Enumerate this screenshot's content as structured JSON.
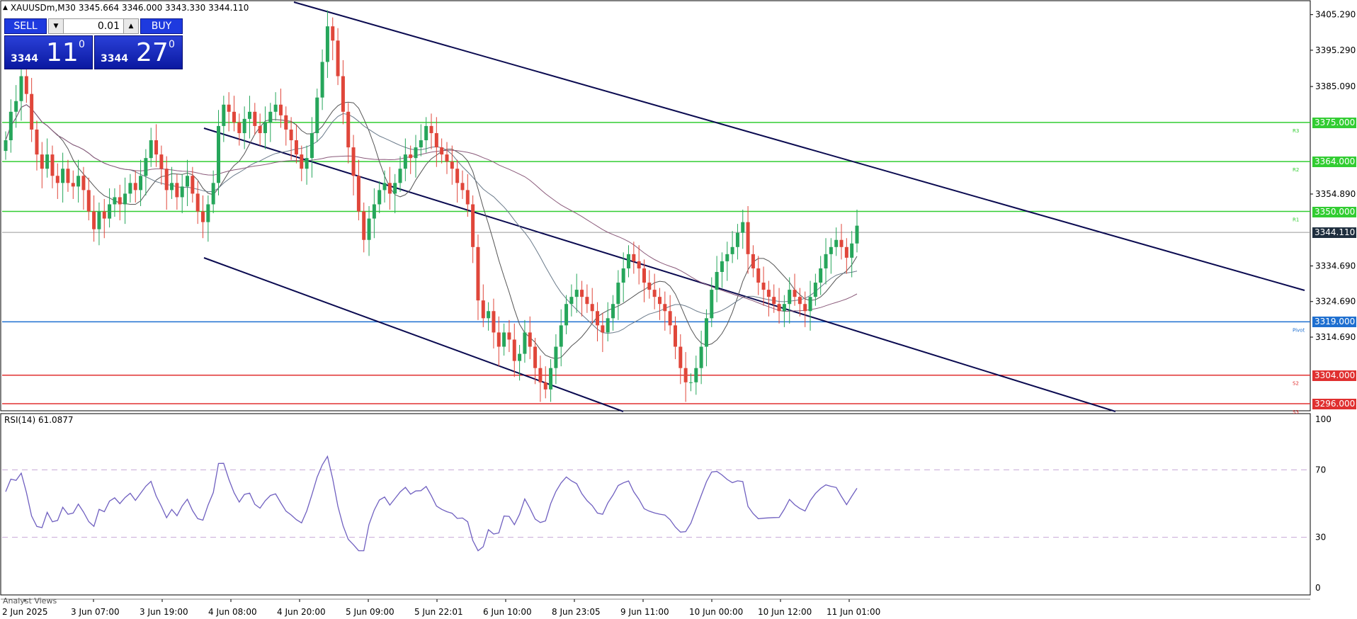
{
  "header": {
    "symbol": "XAUUSDm,M30",
    "ohlc": "3345.664  3346.000  3343.330  3344.110"
  },
  "trade_panel": {
    "sell_label": "SELL",
    "buy_label": "BUY",
    "lot": "0.01",
    "sell_price": {
      "base": "3344",
      "big": "11",
      "sup": "0"
    },
    "buy_price": {
      "base": "3344",
      "big": "27",
      "sup": "0"
    }
  },
  "price_axis": {
    "ticks": [
      "3405.290",
      "3395.290",
      "3385.090",
      "3354.890",
      "3334.690",
      "3324.690",
      "3314.690"
    ],
    "levels": [
      {
        "name": "R3",
        "value": "3375.000",
        "color": "#32cd32"
      },
      {
        "name": "R2",
        "value": "3364.000",
        "color": "#32cd32"
      },
      {
        "name": "R1",
        "value": "3350.000",
        "color": "#32cd32"
      },
      {
        "name": "Pivot",
        "value": "3319.000",
        "color": "#1e6fd0"
      },
      {
        "name": "S2",
        "value": "3304.000",
        "color": "#e03030"
      },
      {
        "name": "S3",
        "value": "3296.000",
        "color": "#e03030"
      }
    ],
    "current": "3344.110"
  },
  "rsi": {
    "label": "RSI(14) 61.0877",
    "ticks": [
      "100",
      "70",
      "30",
      "0"
    ],
    "color": "#7060c0"
  },
  "time_axis": [
    "2 Jun 2025",
    "3 Jun 07:00",
    "3 Jun 19:00",
    "4 Jun 08:00",
    "4 Jun 20:00",
    "5 Jun 09:00",
    "5 Jun 22:01",
    "6 Jun 10:00",
    "8 Jun 23:05",
    "9 Jun 11:00",
    "10 Jun 00:00",
    "10 Jun 12:00",
    "11 Jun 01:00"
  ],
  "footer": {
    "analyst_tab": "Analyst Views"
  },
  "colors": {
    "bull": "#26a65b",
    "bear": "#e0463a",
    "trend": "#0a0a50"
  },
  "chart_data": {
    "type": "candlestick",
    "title": "XAUUSDm,M30",
    "ylim": [
      3294,
      3409
    ],
    "close_series": [
      3370,
      3378,
      3381,
      3388,
      3383,
      3373,
      3366,
      3362,
      3366,
      3360,
      3358,
      3362,
      3358,
      3357,
      3360,
      3356,
      3350,
      3345,
      3350,
      3348,
      3352,
      3354,
      3352,
      3355,
      3358,
      3356,
      3360,
      3365,
      3370,
      3366,
      3362,
      3356,
      3358,
      3354,
      3357,
      3360,
      3355,
      3350,
      3347,
      3352,
      3358,
      3374,
      3380,
      3378,
      3375,
      3372,
      3376,
      3378,
      3374,
      3372,
      3375,
      3378,
      3380,
      3377,
      3373,
      3370,
      3366,
      3362,
      3365,
      3372,
      3382,
      3392,
      3402,
      3398,
      3388,
      3378,
      3368,
      3360,
      3350,
      3342,
      3348,
      3352,
      3356,
      3358,
      3355,
      3358,
      3362,
      3366,
      3365,
      3368,
      3370,
      3374,
      3372,
      3368,
      3366,
      3364,
      3362,
      3358,
      3356,
      3352,
      3340,
      3325,
      3320,
      3322,
      3316,
      3312,
      3316,
      3314,
      3308,
      3310,
      3316,
      3312,
      3306,
      3302,
      3300,
      3306,
      3312,
      3318,
      3324,
      3326,
      3328,
      3326,
      3324,
      3322,
      3318,
      3316,
      3320,
      3324,
      3330,
      3334,
      3338,
      3336,
      3334,
      3330,
      3328,
      3326,
      3324,
      3322,
      3318,
      3312,
      3306,
      3302,
      3302,
      3306,
      3312,
      3320,
      3328,
      3333,
      3336,
      3338,
      3340,
      3344,
      3347,
      3338,
      3334,
      3330,
      3328,
      3326,
      3324,
      3322,
      3324,
      3328,
      3326,
      3324,
      3322,
      3326,
      3330,
      3334,
      3338,
      3340,
      3342,
      3340,
      3337,
      3341,
      3346
    ]
  }
}
